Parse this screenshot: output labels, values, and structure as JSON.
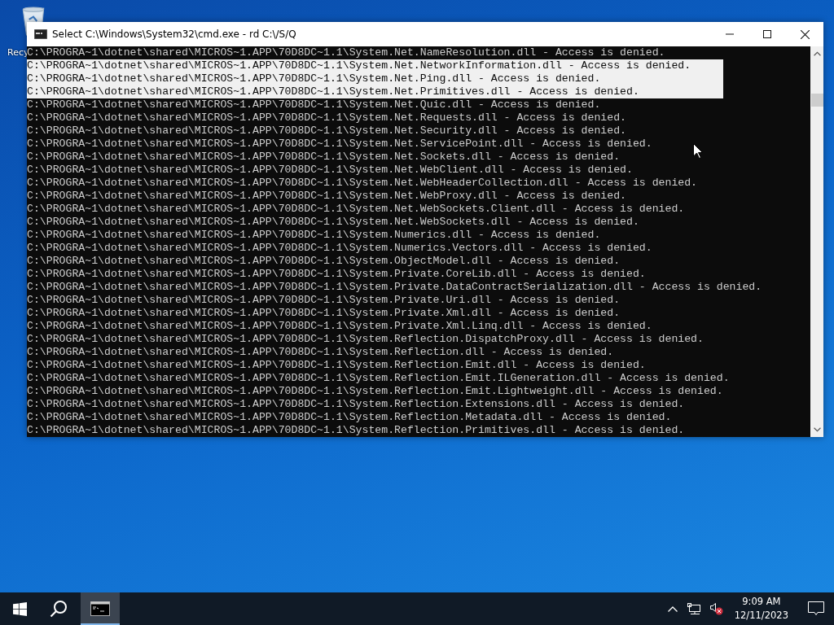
{
  "desktop": {
    "icons": [
      {
        "label": "Recy"
      }
    ]
  },
  "window": {
    "title": "Select C:\\Windows\\System32\\cmd.exe - rd  C:\\/S/Q",
    "lines": [
      {
        "text": "C:\\PROGRA~1\\dotnet\\shared\\MICROS~1.APP\\70D8DC~1.1\\System.Net.NameResolution.dll - Access is denied.",
        "selected": false
      },
      {
        "text": "C:\\PROGRA~1\\dotnet\\shared\\MICROS~1.APP\\70D8DC~1.1\\System.Net.NetworkInformation.dll - Access is denied.",
        "selected": true
      },
      {
        "text": "C:\\PROGRA~1\\dotnet\\shared\\MICROS~1.APP\\70D8DC~1.1\\System.Net.Ping.dll - Access is denied.",
        "selected": true
      },
      {
        "text": "C:\\PROGRA~1\\dotnet\\shared\\MICROS~1.APP\\70D8DC~1.1\\System.Net.Primitives.dll - Access is denied.",
        "selected": true
      },
      {
        "text": "C:\\PROGRA~1\\dotnet\\shared\\MICROS~1.APP\\70D8DC~1.1\\System.Net.Quic.dll - Access is denied.",
        "selected": false
      },
      {
        "text": "C:\\PROGRA~1\\dotnet\\shared\\MICROS~1.APP\\70D8DC~1.1\\System.Net.Requests.dll - Access is denied.",
        "selected": false
      },
      {
        "text": "C:\\PROGRA~1\\dotnet\\shared\\MICROS~1.APP\\70D8DC~1.1\\System.Net.Security.dll - Access is denied.",
        "selected": false
      },
      {
        "text": "C:\\PROGRA~1\\dotnet\\shared\\MICROS~1.APP\\70D8DC~1.1\\System.Net.ServicePoint.dll - Access is denied.",
        "selected": false
      },
      {
        "text": "C:\\PROGRA~1\\dotnet\\shared\\MICROS~1.APP\\70D8DC~1.1\\System.Net.Sockets.dll - Access is denied.",
        "selected": false
      },
      {
        "text": "C:\\PROGRA~1\\dotnet\\shared\\MICROS~1.APP\\70D8DC~1.1\\System.Net.WebClient.dll - Access is denied.",
        "selected": false
      },
      {
        "text": "C:\\PROGRA~1\\dotnet\\shared\\MICROS~1.APP\\70D8DC~1.1\\System.Net.WebHeaderCollection.dll - Access is denied.",
        "selected": false
      },
      {
        "text": "C:\\PROGRA~1\\dotnet\\shared\\MICROS~1.APP\\70D8DC~1.1\\System.Net.WebProxy.dll - Access is denied.",
        "selected": false
      },
      {
        "text": "C:\\PROGRA~1\\dotnet\\shared\\MICROS~1.APP\\70D8DC~1.1\\System.Net.WebSockets.Client.dll - Access is denied.",
        "selected": false
      },
      {
        "text": "C:\\PROGRA~1\\dotnet\\shared\\MICROS~1.APP\\70D8DC~1.1\\System.Net.WebSockets.dll - Access is denied.",
        "selected": false
      },
      {
        "text": "C:\\PROGRA~1\\dotnet\\shared\\MICROS~1.APP\\70D8DC~1.1\\System.Numerics.dll - Access is denied.",
        "selected": false
      },
      {
        "text": "C:\\PROGRA~1\\dotnet\\shared\\MICROS~1.APP\\70D8DC~1.1\\System.Numerics.Vectors.dll - Access is denied.",
        "selected": false
      },
      {
        "text": "C:\\PROGRA~1\\dotnet\\shared\\MICROS~1.APP\\70D8DC~1.1\\System.ObjectModel.dll - Access is denied.",
        "selected": false
      },
      {
        "text": "C:\\PROGRA~1\\dotnet\\shared\\MICROS~1.APP\\70D8DC~1.1\\System.Private.CoreLib.dll - Access is denied.",
        "selected": false
      },
      {
        "text": "C:\\PROGRA~1\\dotnet\\shared\\MICROS~1.APP\\70D8DC~1.1\\System.Private.DataContractSerialization.dll - Access is denied.",
        "selected": false
      },
      {
        "text": "C:\\PROGRA~1\\dotnet\\shared\\MICROS~1.APP\\70D8DC~1.1\\System.Private.Uri.dll - Access is denied.",
        "selected": false
      },
      {
        "text": "C:\\PROGRA~1\\dotnet\\shared\\MICROS~1.APP\\70D8DC~1.1\\System.Private.Xml.dll - Access is denied.",
        "selected": false
      },
      {
        "text": "C:\\PROGRA~1\\dotnet\\shared\\MICROS~1.APP\\70D8DC~1.1\\System.Private.Xml.Linq.dll - Access is denied.",
        "selected": false
      },
      {
        "text": "C:\\PROGRA~1\\dotnet\\shared\\MICROS~1.APP\\70D8DC~1.1\\System.Reflection.DispatchProxy.dll - Access is denied.",
        "selected": false
      },
      {
        "text": "C:\\PROGRA~1\\dotnet\\shared\\MICROS~1.APP\\70D8DC~1.1\\System.Reflection.dll - Access is denied.",
        "selected": false
      },
      {
        "text": "C:\\PROGRA~1\\dotnet\\shared\\MICROS~1.APP\\70D8DC~1.1\\System.Reflection.Emit.dll - Access is denied.",
        "selected": false
      },
      {
        "text": "C:\\PROGRA~1\\dotnet\\shared\\MICROS~1.APP\\70D8DC~1.1\\System.Reflection.Emit.ILGeneration.dll - Access is denied.",
        "selected": false
      },
      {
        "text": "C:\\PROGRA~1\\dotnet\\shared\\MICROS~1.APP\\70D8DC~1.1\\System.Reflection.Emit.Lightweight.dll - Access is denied.",
        "selected": false
      },
      {
        "text": "C:\\PROGRA~1\\dotnet\\shared\\MICROS~1.APP\\70D8DC~1.1\\System.Reflection.Extensions.dll - Access is denied.",
        "selected": false
      },
      {
        "text": "C:\\PROGRA~1\\dotnet\\shared\\MICROS~1.APP\\70D8DC~1.1\\System.Reflection.Metadata.dll - Access is denied.",
        "selected": false
      },
      {
        "text": "C:\\PROGRA~1\\dotnet\\shared\\MICROS~1.APP\\70D8DC~1.1\\System.Reflection.Primitives.dll - Access is denied.",
        "selected": false
      }
    ]
  },
  "taskbar": {
    "apps": [
      {
        "selected": true
      }
    ],
    "clock": {
      "time": "9:09 AM",
      "date": "12/11/2023"
    }
  }
}
